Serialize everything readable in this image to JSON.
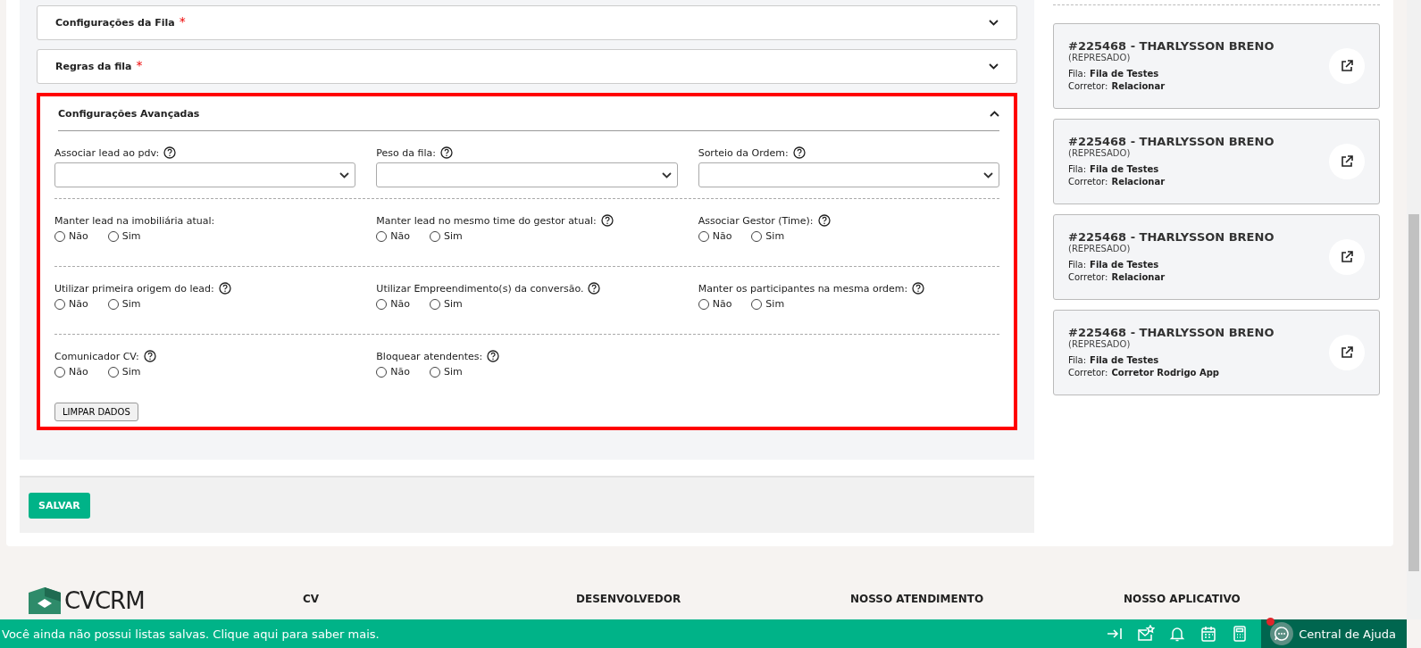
{
  "accordions": [
    {
      "title": "Configurações da Fila",
      "required_mark": "*",
      "expanded": false
    },
    {
      "title": "Regras da fila",
      "required_mark": "*",
      "expanded": false
    }
  ],
  "advanced": {
    "title": "Configurações Avançadas",
    "expanded": true,
    "rows": [
      {
        "kind": "select",
        "fields": [
          {
            "label": "Associar lead ao pdv:",
            "help": true
          },
          {
            "label": "Peso da fila:",
            "help": true
          },
          {
            "label": "Sorteio da Ordem:",
            "help": true
          }
        ]
      },
      {
        "kind": "radio",
        "fields": [
          {
            "label": "Manter lead na imobiliária atual:",
            "help": false,
            "options": [
              {
                "label": "Não",
                "selected": false
              },
              {
                "label": "Sim",
                "selected": false
              }
            ]
          },
          {
            "label": "Manter lead no mesmo time do gestor atual:",
            "help": true,
            "options": [
              {
                "label": "Não",
                "selected": false
              },
              {
                "label": "Sim",
                "selected": false
              }
            ]
          },
          {
            "label": "Associar Gestor (Time):",
            "help": true,
            "options": [
              {
                "label": "Não",
                "selected": false
              },
              {
                "label": "Sim",
                "selected": false
              }
            ]
          }
        ]
      },
      {
        "kind": "radio",
        "fields": [
          {
            "label": "Utilizar primeira origem do lead:",
            "help": true,
            "options": [
              {
                "label": "Não",
                "selected": false
              },
              {
                "label": "Sim",
                "selected": false
              }
            ]
          },
          {
            "label": "Utilizar Empreendimento(s) da conversão.",
            "help": true,
            "options": [
              {
                "label": "Não",
                "selected": false
              },
              {
                "label": "Sim",
                "selected": false
              }
            ]
          },
          {
            "label": "Manter os participantes na mesma ordem:",
            "help": true,
            "options": [
              {
                "label": "Não",
                "selected": false
              },
              {
                "label": "Sim",
                "selected": false
              }
            ]
          }
        ]
      },
      {
        "kind": "radio",
        "fields": [
          {
            "label": "Comunicador CV:",
            "help": true,
            "options": [
              {
                "label": "Não",
                "selected": false
              },
              {
                "label": "Sim",
                "selected": false
              }
            ]
          },
          {
            "label": "Bloquear atendentes:",
            "help": true,
            "options": [
              {
                "label": "Não",
                "selected": false
              },
              {
                "label": "Sim",
                "selected": false
              }
            ]
          }
        ]
      }
    ],
    "clear_button": "LIMPAR DADOS"
  },
  "save_button": "SALVAR",
  "cards": [
    {
      "title": "#225468 - THARLYSSON BRENO",
      "status": "(REPRESADO)",
      "fila_label": "Fila:",
      "fila": "Fila de Testes",
      "corretor_label": "Corretor:",
      "corretor": "Relacionar"
    },
    {
      "title": "#225468 - THARLYSSON BRENO",
      "status": "(REPRESADO)",
      "fila_label": "Fila:",
      "fila": "Fila de Testes",
      "corretor_label": "Corretor:",
      "corretor": "Relacionar"
    },
    {
      "title": "#225468 - THARLYSSON BRENO",
      "status": "(REPRESADO)",
      "fila_label": "Fila:",
      "fila": "Fila de Testes",
      "corretor_label": "Corretor:",
      "corretor": "Relacionar"
    },
    {
      "title": "#225468 - THARLYSSON BRENO",
      "status": "(REPRESADO)",
      "fila_label": "Fila:",
      "fila": "Fila de Testes",
      "corretor_label": "Corretor:",
      "corretor": "Corretor Rodrigo App"
    }
  ],
  "footer": {
    "logo": "CVCRM",
    "headings": [
      "CV",
      "DESENVOLVEDOR",
      "NOSSO ATENDIMENTO",
      "NOSSO APLICATIVO"
    ]
  },
  "bottom_bar": {
    "message": "Você ainda não possui listas salvas. Clique aqui para saber mais.",
    "help": "Central de Ajuda",
    "help_notification": true
  }
}
